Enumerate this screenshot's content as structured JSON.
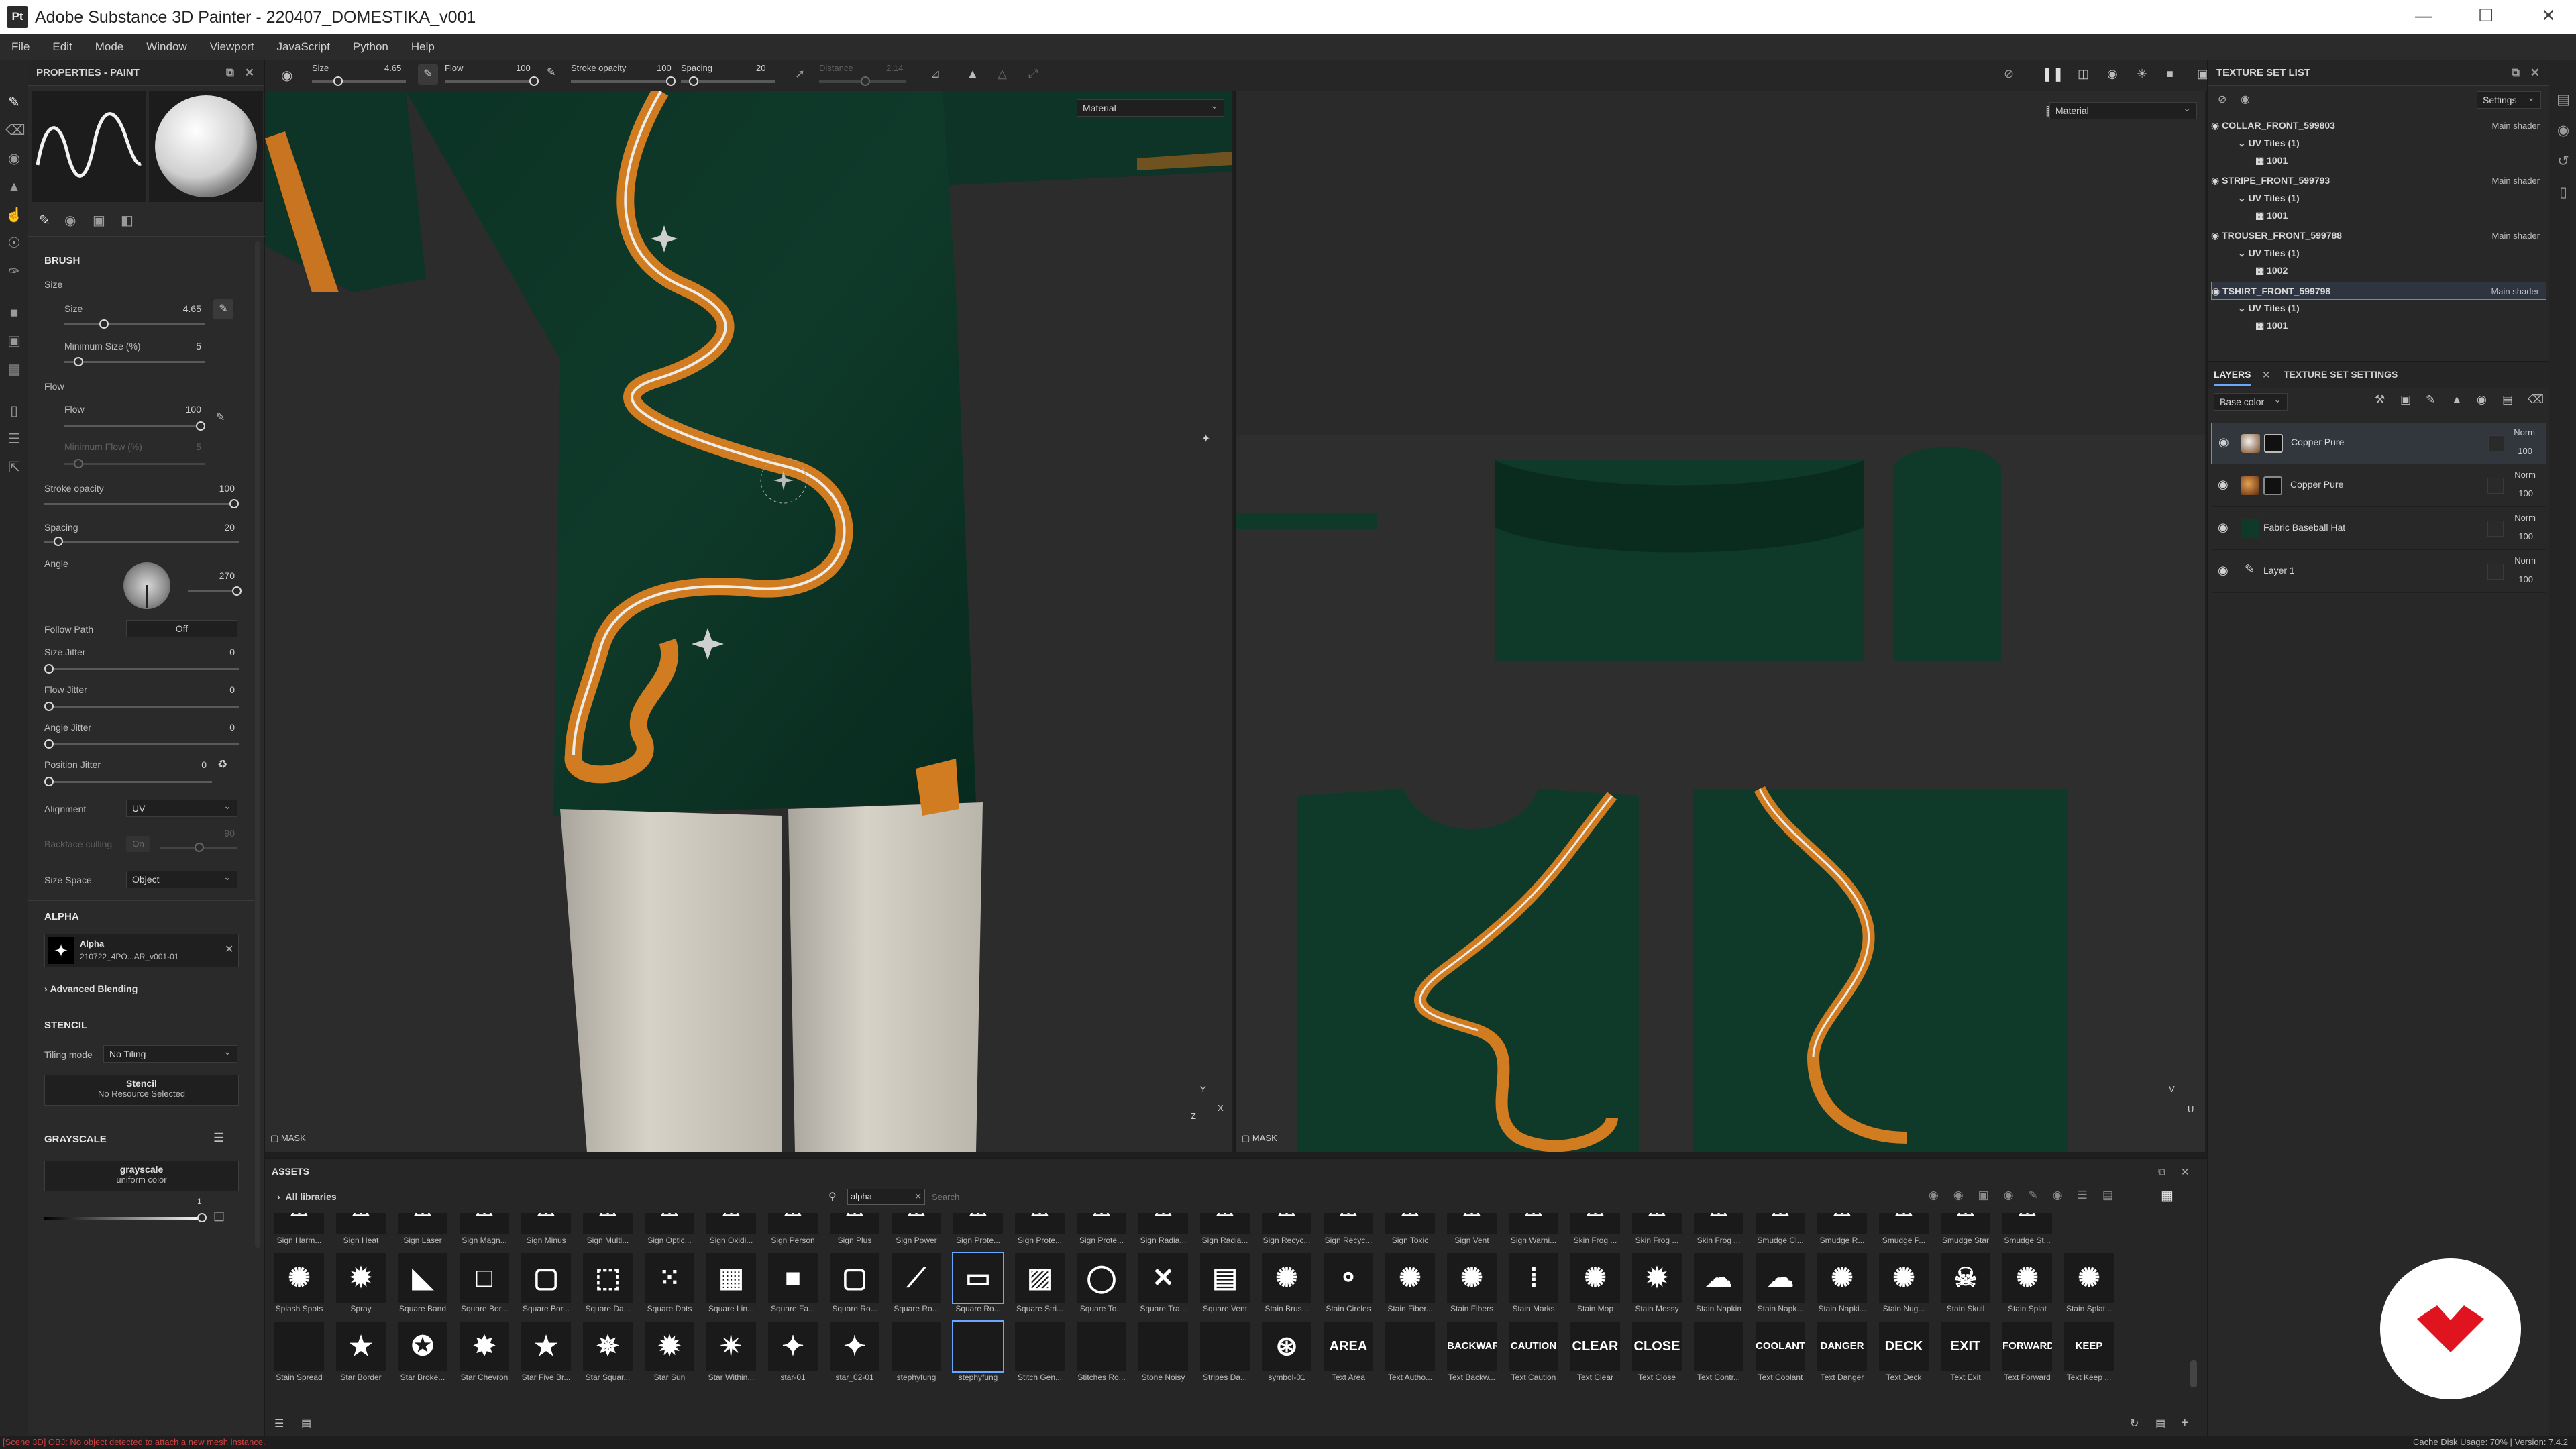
{
  "window": {
    "app_icon": "Pt",
    "title": "Adobe Substance 3D Painter - 220407_DOMESTIKA_v001"
  },
  "menu": [
    "File",
    "Edit",
    "Mode",
    "Window",
    "Viewport",
    "JavaScript",
    "Python",
    "Help"
  ],
  "toolbar": {
    "size_label": "Size",
    "size_value": "4.65",
    "flow_label": "Flow",
    "flow_value": "100",
    "stroke_opacity_label": "Stroke opacity",
    "stroke_opacity_value": "100",
    "spacing_label": "Spacing",
    "spacing_value": "20",
    "distance_label": "Distance",
    "distance_value": "2.14"
  },
  "properties": {
    "title": "PROPERTIES - PAINT",
    "brush_section": "BRUSH",
    "size_group": "Size",
    "size_label": "Size",
    "size_value": "4.65",
    "min_size_label": "Minimum Size (%)",
    "min_size_value": "5",
    "flow_group": "Flow",
    "flow_label": "Flow",
    "flow_value": "100",
    "min_flow_label": "Minimum Flow (%)",
    "min_flow_value": "5",
    "stroke_opacity_label": "Stroke opacity",
    "stroke_opacity_value": "100",
    "spacing_label": "Spacing",
    "spacing_value": "20",
    "angle_label": "Angle",
    "angle_value": "270",
    "follow_path_label": "Follow Path",
    "follow_path_value": "Off",
    "size_jitter_label": "Size Jitter",
    "size_jitter_value": "0",
    "flow_jitter_label": "Flow Jitter",
    "flow_jitter_value": "0",
    "angle_jitter_label": "Angle Jitter",
    "angle_jitter_value": "0",
    "position_jitter_label": "Position Jitter",
    "position_jitter_value": "0",
    "alignment_label": "Alignment",
    "alignment_value": "UV",
    "backface_label": "Backface culling",
    "backface_value": "On",
    "backface_number": "90",
    "size_space_label": "Size Space",
    "size_space_value": "Object",
    "alpha_section": "ALPHA",
    "alpha_name": "Alpha",
    "alpha_file": "210722_4PO...AR_v001-01",
    "advanced_blending": "Advanced Blending",
    "stencil_section": "STENCIL",
    "tiling_label": "Tiling mode",
    "tiling_value": "No Tiling",
    "stencil_title": "Stencil",
    "stencil_sub": "No Resource Selected",
    "grayscale_section": "GRAYSCALE",
    "grayscale_title": "grayscale",
    "grayscale_sub": "uniform color",
    "grayscale_value": "1"
  },
  "viewport3d": {
    "material_dropdown": "Material",
    "mask_label": "MASK",
    "axis_y": "Y",
    "axis_z": "Z",
    "axis_x": "X"
  },
  "viewport2d": {
    "material_dropdown": "Material",
    "mask_label": "MASK",
    "axis_v": "V",
    "axis_u": "U"
  },
  "texture_set_list": {
    "title": "TEXTURE SET LIST",
    "settings": "Settings",
    "sets": [
      {
        "name": "COLLAR_FRONT_599803",
        "shader": "Main shader",
        "uv": "UV Tiles (1)",
        "tile": "1001"
      },
      {
        "name": "STRIPE_FRONT_599793",
        "shader": "Main shader",
        "uv": "UV Tiles (1)",
        "tile": "1001"
      },
      {
        "name": "TROUSER_FRONT_599788",
        "shader": "Main shader",
        "uv": "UV Tiles (1)",
        "tile": "1002"
      },
      {
        "name": "TSHIRT_FRONT_599798",
        "shader": "Main shader",
        "uv": "UV Tiles (1)",
        "tile": "1001"
      }
    ]
  },
  "layers": {
    "tab_layers": "LAYERS",
    "tab_tss": "TEXTURE SET SETTINGS",
    "channel_dropdown": "Base color",
    "items": [
      {
        "name": "Copper Pure",
        "blend": "Norm",
        "opacity": "100"
      },
      {
        "name": "Copper Pure",
        "blend": "Norm",
        "opacity": "100"
      },
      {
        "name": "Fabric Baseball Hat",
        "blend": "Norm",
        "opacity": "100"
      },
      {
        "name": "Layer 1",
        "blend": "Norm",
        "opacity": "100"
      }
    ]
  },
  "assets": {
    "title": "ASSETS",
    "library": "All libraries",
    "search_value": "alpha",
    "search_placeholder": "Search",
    "row1": [
      "Sign Harm...",
      "Sign Heat",
      "Sign Laser",
      "Sign Magn...",
      "Sign Minus",
      "Sign Multi...",
      "Sign Optic...",
      "Sign Oxidi...",
      "Sign Person",
      "Sign Plus",
      "Sign Power",
      "Sign Prote...",
      "Sign Prote...",
      "Sign Prote...",
      "Sign Radia...",
      "Sign Radia...",
      "Sign Recyc...",
      "Sign Recyc...",
      "Sign Toxic",
      "Sign Vent",
      "Sign Warni...",
      "Skin Frog ...",
      "Skin Frog ...",
      "Skin Frog ...",
      "Smudge Cl...",
      "Smudge R...",
      "Smudge P...",
      "Smudge Star",
      "Smudge St..."
    ],
    "row2": [
      "Splash Spots",
      "Spray",
      "Square Band",
      "Square Bor...",
      "Square Bor...",
      "Square Da...",
      "Square Dots",
      "Square Lin...",
      "Square Fa...",
      "Square Ro...",
      "Square Ro...",
      "Square Ro...",
      "Square Stri...",
      "Square To...",
      "Square Tra...",
      "Square Vent",
      "Stain Brus...",
      "Stain Circles",
      "Stain Fiber...",
      "Stain Fibers",
      "Stain Marks",
      "Stain Mop",
      "Stain Mossy",
      "Stain Napkin",
      "Stain Napk...",
      "Stain Napki...",
      "Stain Nug...",
      "Stain Skull",
      "Stain Splat",
      "Stain Splat..."
    ],
    "row3": [
      "Stain Spread",
      "Star Border",
      "Star Broke...",
      "Star Chevron",
      "Star Five Br...",
      "Star Squar...",
      "Star Sun",
      "Star Within...",
      "star-01",
      "star_02-01",
      "stephyfung",
      "stephyfung",
      "Stitch Gen...",
      "Stitches Ro...",
      "Stone Noisy",
      "Stripes Da...",
      "symbol-01",
      "Text Area",
      "Text Autho...",
      "Text Backw...",
      "Text Caution",
      "Text Clear",
      "Text Close",
      "Text Contr...",
      "Text Coolant",
      "Text Danger",
      "Text Deck",
      "Text Exit",
      "Text Forward",
      "Text Keep ..."
    ],
    "row3_glyphs": [
      "",
      "★",
      "✪",
      "✸",
      "★",
      "✵",
      "✹",
      "✴",
      "✦",
      "✦",
      "",
      "",
      "",
      "",
      "",
      "",
      "⊛",
      "AREA",
      "",
      "BACKWARD",
      "CAUTION",
      "CLEAR",
      "CLOSE",
      "",
      "COOLANT",
      "DANGER",
      "DECK",
      "EXIT",
      "FORWARD",
      "KEEP OUT"
    ]
  },
  "statusbar": {
    "error": "[Scene 3D] OBJ: No object detected to attach a new mesh instance.",
    "right": "Cache Disk Usage:  70% | Version: 7.4.2"
  },
  "colors": {
    "shirt": "#0f3a2a",
    "copper": "#d07a22",
    "trouser": "#cfcbc1",
    "accent": "#6aa7ff",
    "badge": "#e0141e",
    "error": "#d04040"
  }
}
